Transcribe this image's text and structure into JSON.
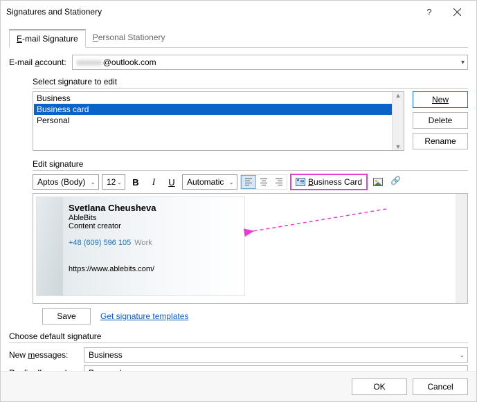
{
  "title": "Signatures and Stationery",
  "tabs": [
    "E-mail Signature",
    "Personal Stationery"
  ],
  "active_tab": 0,
  "account": "@outlook.com",
  "labels": {
    "email_account": "E-mail account:",
    "select_to_edit": "Select signature to edit",
    "edit_signature": "Edit signature",
    "choose_default": "Choose default signature",
    "new_messages": "New messages:",
    "replies_forwards": "Replies/forwards:",
    "templates_link": "Get signature templates"
  },
  "signatures": [
    "Business",
    "Business card",
    "Personal"
  ],
  "selected_signature_index": 1,
  "buttons": {
    "new": "New",
    "delete": "Delete",
    "rename": "Rename",
    "save": "Save",
    "ok": "OK",
    "cancel": "Cancel"
  },
  "toolbar": {
    "font": "Aptos (Body)",
    "size": "12",
    "color": "Automatic",
    "align": "left",
    "business_card": "Business Card"
  },
  "card": {
    "name": "Svetlana Cheusheva",
    "company": "AbleBits",
    "role": "Content creator",
    "phone": "+48 (609) 596 105",
    "phone_tag": " Work",
    "website": "https://www.ablebits.com/"
  },
  "defaults": {
    "new_messages": "Business",
    "replies_forwards": "Personal"
  },
  "annotation": {
    "highlight_color": "#e83ecf",
    "highlighted_button": "business-card-button"
  }
}
